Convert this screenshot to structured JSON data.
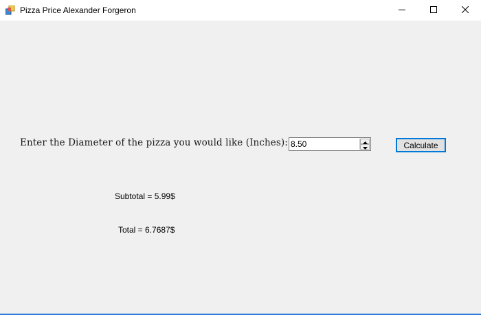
{
  "window": {
    "title": "Pizza Price Alexander Forgeron",
    "app_icon": "winforms-app-icon",
    "caption_buttons": [
      "minimize-icon",
      "maximize-icon",
      "close-icon"
    ]
  },
  "form": {
    "prompt_label": "Enter the Diameter of the pizza you would like (Inches):",
    "diameter_value": "8.50",
    "calculate_label": "Calculate",
    "subtotal_text": "Subtotal = 5.99$",
    "total_text": "Total = 6.7687$"
  },
  "colors": {
    "window_bg": "#f0f0f0",
    "titlebar_bg": "#ffffff",
    "accent": "#0078d7"
  }
}
